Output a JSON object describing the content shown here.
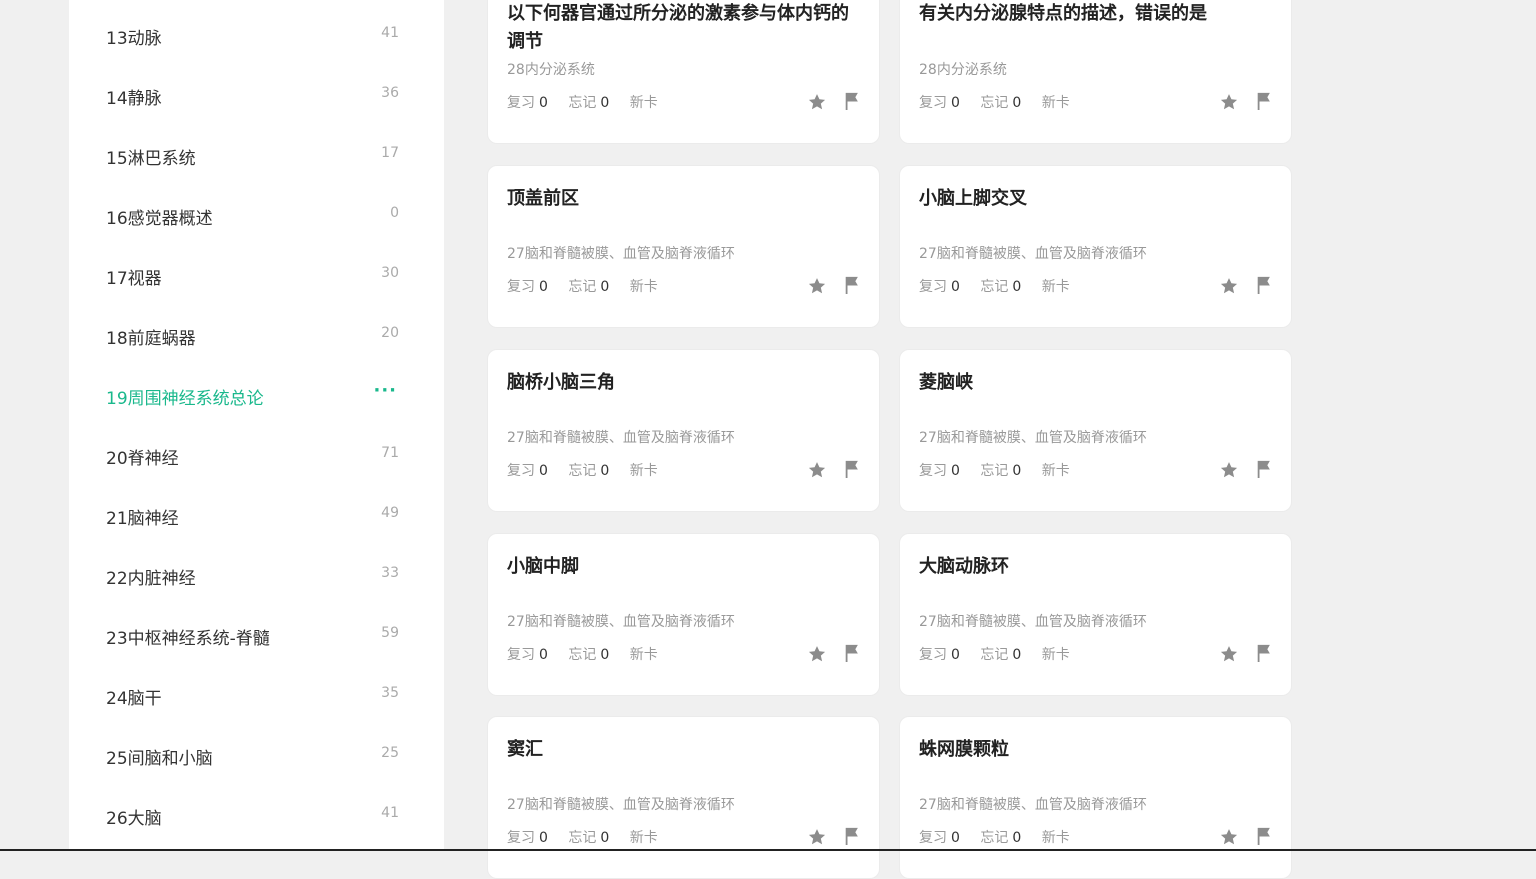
{
  "sidebar": {
    "items": [
      {
        "label": "13动脉",
        "count": "41"
      },
      {
        "label": "14静脉",
        "count": "36"
      },
      {
        "label": "15淋巴系统",
        "count": "17"
      },
      {
        "label": "16感觉器概述",
        "count": "0"
      },
      {
        "label": "17视器",
        "count": "30"
      },
      {
        "label": "18前庭蜗器",
        "count": "20"
      },
      {
        "label": "19周围神经系统总论",
        "more": "···"
      },
      {
        "label": "20脊神经",
        "count": "71"
      },
      {
        "label": "21脑神经",
        "count": "49"
      },
      {
        "label": "22内脏神经",
        "count": "33"
      },
      {
        "label": "23中枢神经系统-脊髓",
        "count": "59"
      },
      {
        "label": "24脑干",
        "count": "35"
      },
      {
        "label": "25间脑和小脑",
        "count": "25"
      },
      {
        "label": "26大脑",
        "count": "41"
      }
    ],
    "active_color": "#1ab88c"
  },
  "stat_labels": {
    "review": "复习",
    "forget": "忘记",
    "new": "新卡"
  },
  "cards": [
    {
      "title": "以下何器官通过所分泌的激素参与体内钙的调节",
      "subtitle": "28内分泌系统",
      "review": "0",
      "forget": "0"
    },
    {
      "title": "有关内分泌腺特点的描述，错误的是",
      "subtitle": "28内分泌系统",
      "review": "0",
      "forget": "0"
    },
    {
      "title": "顶盖前区",
      "subtitle": "27脑和脊髓被膜、血管及脑脊液循环",
      "review": "0",
      "forget": "0"
    },
    {
      "title": "小脑上脚交叉",
      "subtitle": "27脑和脊髓被膜、血管及脑脊液循环",
      "review": "0",
      "forget": "0"
    },
    {
      "title": "脑桥小脑三角",
      "subtitle": "27脑和脊髓被膜、血管及脑脊液循环",
      "review": "0",
      "forget": "0"
    },
    {
      "title": "菱脑峡",
      "subtitle": "27脑和脊髓被膜、血管及脑脊液循环",
      "review": "0",
      "forget": "0"
    },
    {
      "title": "小脑中脚",
      "subtitle": "27脑和脊髓被膜、血管及脑脊液循环",
      "review": "0",
      "forget": "0"
    },
    {
      "title": "大脑动脉环",
      "subtitle": "27脑和脊髓被膜、血管及脑脊液循环",
      "review": "0",
      "forget": "0"
    },
    {
      "title": "窦汇",
      "subtitle": "27脑和脊髓被膜、血管及脑脊液循环",
      "review": "0",
      "forget": "0"
    },
    {
      "title": "蛛网膜颗粒",
      "subtitle": "27脑和脊髓被膜、血管及脑脊液循环",
      "review": "0",
      "forget": "0"
    }
  ],
  "icons": {
    "star": "star-icon",
    "flag": "flag-icon"
  }
}
